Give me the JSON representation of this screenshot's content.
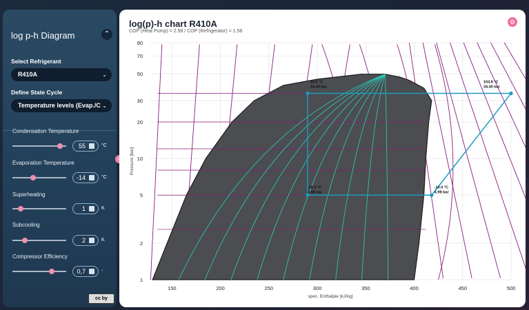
{
  "sidebar": {
    "title": "log p-h Diagram",
    "collapse_glyph": "⌃",
    "select_refrigerant_label": "Select Refrigerant",
    "refrigerant_value": "R410A",
    "define_cycle_label": "Define State Cycle",
    "cycle_value": "Temperature levels (Evap./C",
    "dropdown_glyph": "⌄",
    "params": [
      {
        "label": "Condensation Temperature",
        "value": "55",
        "unit": "°C",
        "slider_fraction": 0.88
      },
      {
        "label": "Evaporation Temperature",
        "value": "-14",
        "unit": "°C",
        "slider_fraction": 0.38
      },
      {
        "label": "Superheating",
        "value": "1",
        "unit": "K",
        "slider_fraction": 0.16
      },
      {
        "label": "Subcooling",
        "value": "2",
        "unit": "K",
        "slider_fraction": 0.23
      },
      {
        "label": "Compressor Efficiency",
        "value": "0,7",
        "unit": "-",
        "slider_fraction": 0.73
      }
    ],
    "license_badge": "cc by"
  },
  "toggle_glyph": "‹",
  "main": {
    "title": "log(p)-h chart R410A",
    "subtitle": "COP (Heat Pump) = 2.58 / COP (Refrigerator) = 1.58",
    "settings_glyph": "⚙"
  },
  "colors": {
    "dome_fill": "#4b4d50",
    "dome_edge": "#1c1c1c",
    "isotherm": "#8b1a7a",
    "quality_line": "#2ad1bf",
    "cycle": "#1a9ac4",
    "accent": "#f06fa0"
  },
  "chart_data": {
    "type": "line",
    "title": "log(p)-h chart R410A",
    "xlabel": "spec. Enthalpie [kJ/kg]",
    "ylabel": "Pressure [bar]",
    "xlim": [
      127,
      500
    ],
    "ylim": [
      1,
      90
    ],
    "yscale": "log",
    "x_ticks": [
      150,
      200,
      250,
      300,
      350,
      400,
      450,
      500
    ],
    "y_ticks": [
      1,
      2,
      5,
      10,
      20,
      30,
      50,
      70,
      90
    ],
    "saturation_dome": {
      "liquid": [
        [
          130,
          1
        ],
        [
          145,
          2
        ],
        [
          165,
          5
        ],
        [
          185,
          10
        ],
        [
          212,
          20
        ],
        [
          235,
          30
        ],
        [
          265,
          40
        ],
        [
          300,
          45
        ],
        [
          345,
          49.5
        ],
        [
          370,
          49.5
        ]
      ],
      "vapor": [
        [
          370,
          49.5
        ],
        [
          385,
          47
        ],
        [
          395,
          44
        ],
        [
          410,
          38
        ],
        [
          418,
          30
        ],
        [
          415,
          20
        ],
        [
          412,
          10
        ],
        [
          410,
          5
        ],
        [
          405,
          2
        ],
        [
          400,
          1
        ]
      ]
    },
    "cycle_points": [
      {
        "label": "53.0 °C\n34.40 bar",
        "h": 290,
        "p": 34.4
      },
      {
        "label": "104.8 °C\n34.40 bar",
        "h": 500,
        "p": 34.4
      },
      {
        "label": "-13.0 °C\n4.98 bar",
        "h": 418,
        "p": 4.98
      },
      {
        "label": "-16.0 °C\n4.98 bar",
        "h": 290,
        "p": 4.98
      }
    ]
  }
}
